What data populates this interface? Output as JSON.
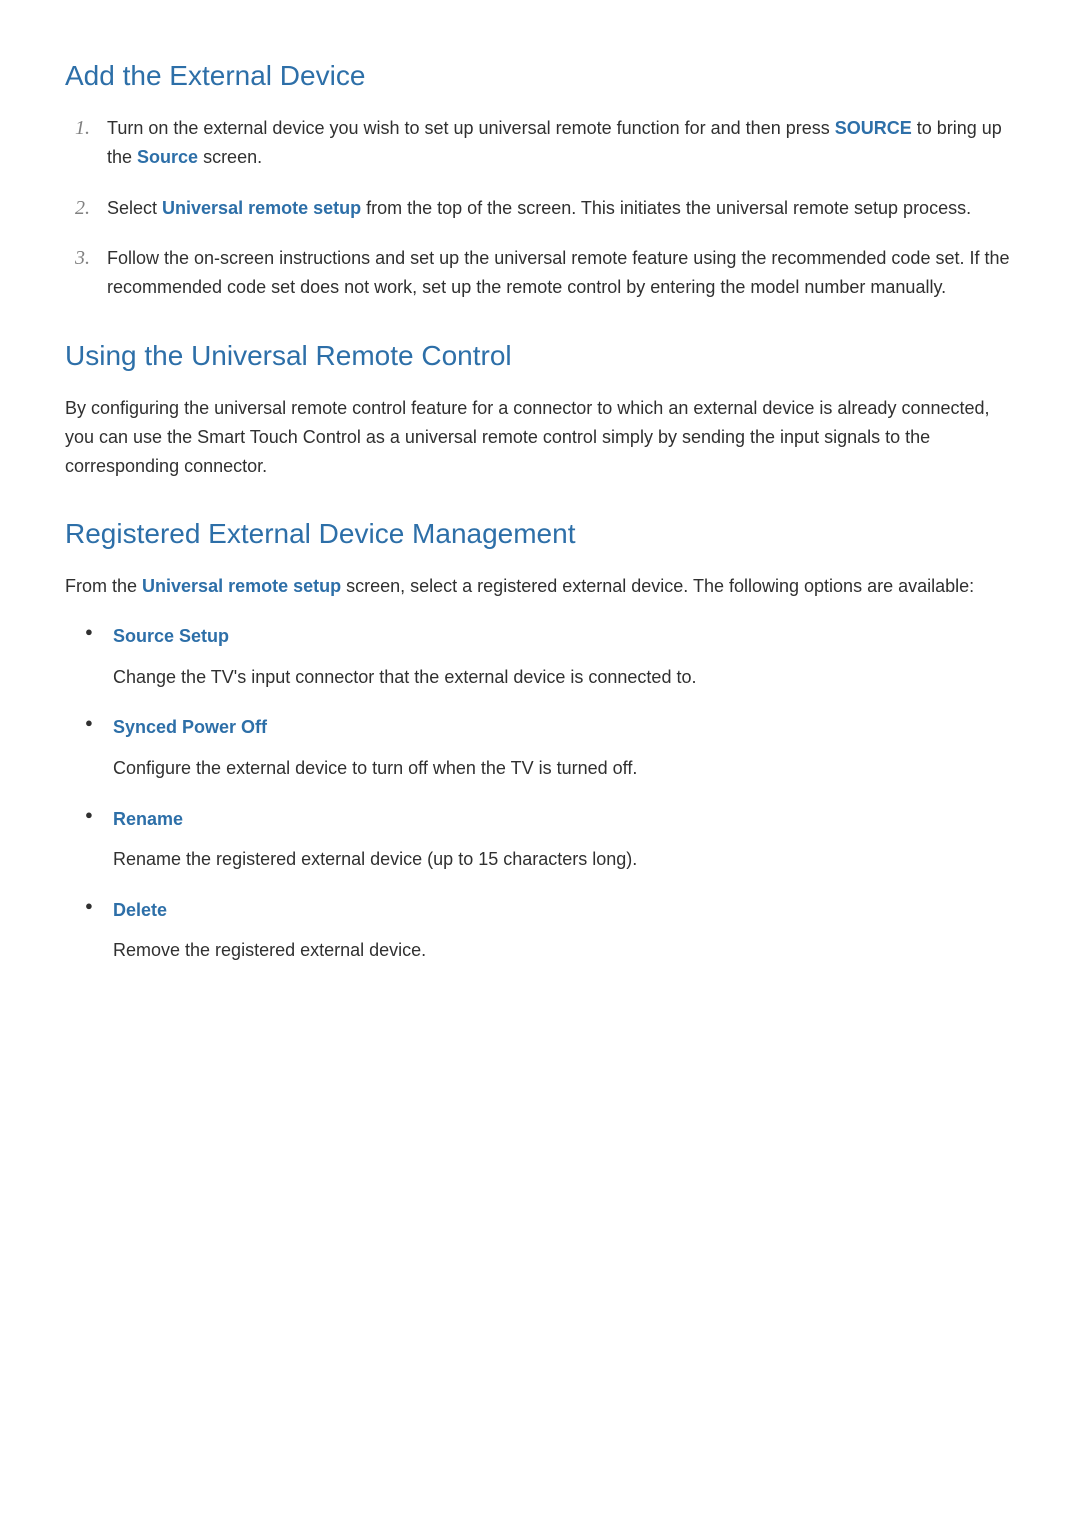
{
  "section1": {
    "title": "Add the External Device",
    "items": [
      {
        "num": "1.",
        "text_before": "Turn on the external device you wish to set up universal remote function for and then press ",
        "highlight1": "SOURCE",
        "text_mid": " to bring up the ",
        "highlight2": "Source",
        "text_after": " screen."
      },
      {
        "num": "2.",
        "text_before": "Select ",
        "highlight1": "Universal remote setup",
        "text_after": " from the top of the screen. This initiates the universal remote setup process."
      },
      {
        "num": "3.",
        "text": "Follow the on-screen instructions and set up the universal remote feature using the recommended code set. If the recommended code set does not work, set up the remote control by entering the model number manually."
      }
    ]
  },
  "section2": {
    "title": "Using the Universal Remote Control",
    "text": "By configuring the universal remote control feature for a connector to which an external device is already connected, you can use the Smart Touch Control as a universal remote control simply by sending the input signals to the corresponding connector."
  },
  "section3": {
    "title": "Registered External Device Management",
    "intro_before": "From the ",
    "intro_highlight": "Universal remote setup",
    "intro_after": " screen, select a registered external device. The following options are available:",
    "options": [
      {
        "title": "Source Setup",
        "desc": "Change the TV's input connector that the external device is connected to."
      },
      {
        "title": "Synced Power Off",
        "desc": "Configure the external device to turn off when the TV is turned off."
      },
      {
        "title": "Rename",
        "desc": "Rename the registered external device (up to 15 characters long)."
      },
      {
        "title": "Delete",
        "desc": "Remove the registered external device."
      }
    ]
  }
}
